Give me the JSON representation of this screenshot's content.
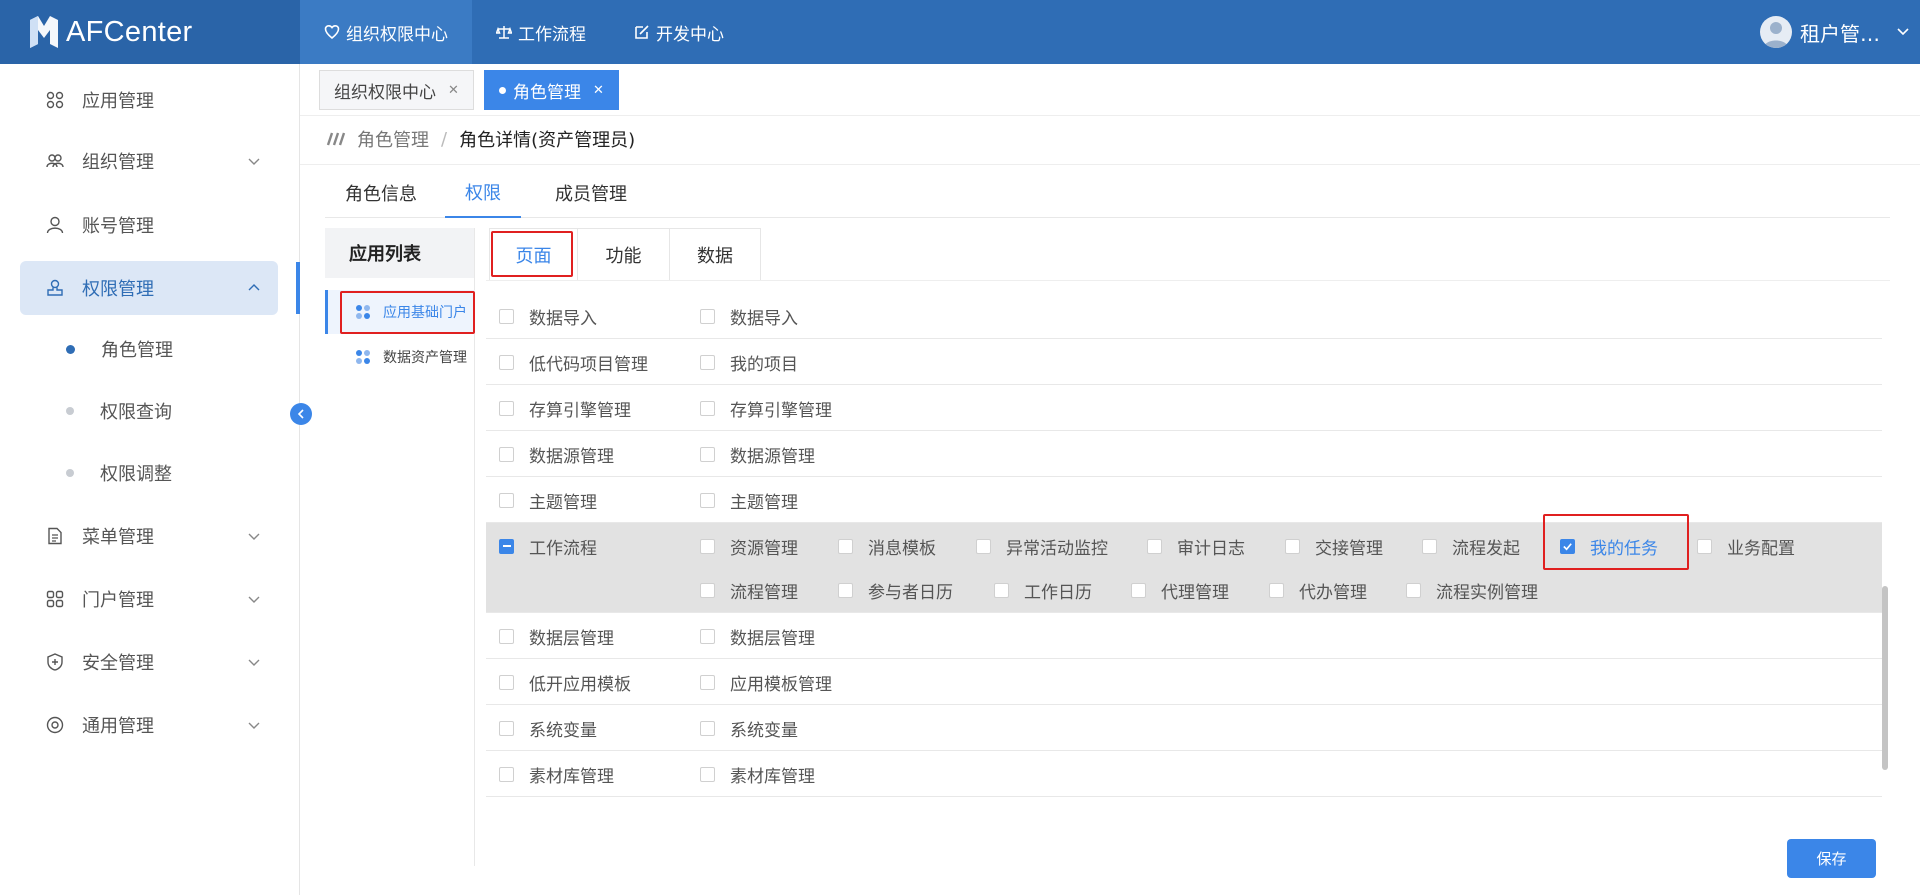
{
  "app": {
    "logo_text": "AFCenter"
  },
  "topnav": [
    {
      "label": "组织权限中心",
      "icon": "shield-heart-icon"
    },
    {
      "label": "工作流程",
      "icon": "scale-icon"
    },
    {
      "label": "开发中心",
      "icon": "edit-icon"
    }
  ],
  "user": {
    "name": "租户管…"
  },
  "sidebar": {
    "items": [
      {
        "label": "应用管理"
      },
      {
        "label": "组织管理"
      },
      {
        "label": "账号管理"
      },
      {
        "label": "权限管理"
      },
      {
        "label": "菜单管理"
      },
      {
        "label": "门户管理"
      },
      {
        "label": "安全管理"
      },
      {
        "label": "通用管理"
      }
    ],
    "sub": [
      {
        "label": "角色管理"
      },
      {
        "label": "权限查询"
      },
      {
        "label": "权限调整"
      }
    ]
  },
  "tabs": [
    {
      "label": "组织权限中心"
    },
    {
      "label": "角色管理"
    }
  ],
  "breadcrumb": {
    "parent": "角色管理",
    "sep": "/",
    "current": "角色详情(资产管理员)"
  },
  "subtabs": [
    "角色信息",
    "权限",
    "成员管理"
  ],
  "applist": {
    "title": "应用列表",
    "items": [
      "应用基础门户",
      "数据资产管理"
    ]
  },
  "permtabs": [
    "页面",
    "功能",
    "数据"
  ],
  "rows": [
    {
      "module": "数据导入",
      "pages": [
        "数据导入"
      ]
    },
    {
      "module": "低代码项目管理",
      "pages": [
        "我的项目"
      ]
    },
    {
      "module": "存算引擎管理",
      "pages": [
        "存算引擎管理"
      ]
    },
    {
      "module": "数据源管理",
      "pages": [
        "数据源管理"
      ]
    },
    {
      "module": "主题管理",
      "pages": [
        "主题管理"
      ]
    },
    {
      "module": "工作流程",
      "pages": [
        "资源管理",
        "消息模板",
        "异常活动监控",
        "审计日志",
        "交接管理",
        "流程发起",
        "我的任务",
        "业务配置",
        "流程管理",
        "参与者日历",
        "工作日历",
        "代理管理",
        "代办管理",
        "流程实例管理"
      ]
    },
    {
      "module": "数据层管理",
      "pages": [
        "数据层管理"
      ]
    },
    {
      "module": "低开应用模板",
      "pages": [
        "应用模板管理"
      ]
    },
    {
      "module": "系统变量",
      "pages": [
        "系统变量"
      ]
    },
    {
      "module": "素材库管理",
      "pages": [
        "素材库管理"
      ]
    }
  ],
  "checked": {
    "工作流程": "indeterminate",
    "我的任务": "checked"
  },
  "actions": {
    "save_label": "保存"
  },
  "colors": {
    "header": "#2f6db5",
    "accent": "#3b86e8",
    "highlight": "#e02020"
  }
}
